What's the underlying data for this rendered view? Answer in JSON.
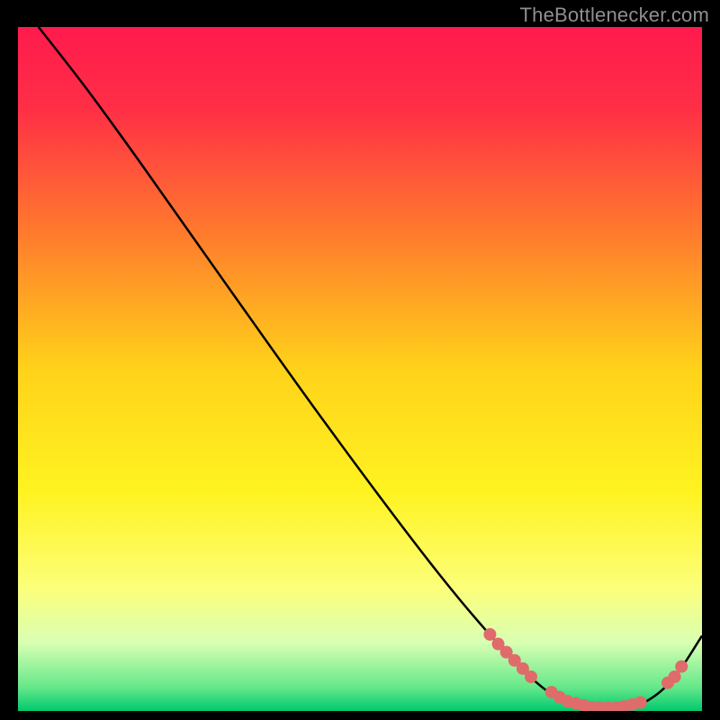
{
  "attribution": "TheBottlenecker.com",
  "chart_data": {
    "type": "line",
    "title": "",
    "xlabel": "",
    "ylabel": "",
    "xlim": [
      0,
      100
    ],
    "ylim": [
      0,
      100
    ],
    "background_gradient": {
      "stops": [
        {
          "pos": 0.0,
          "color": "#ff1a4d"
        },
        {
          "pos": 0.12,
          "color": "#ff2f46"
        },
        {
          "pos": 0.3,
          "color": "#ff7a2d"
        },
        {
          "pos": 0.5,
          "color": "#ffd21a"
        },
        {
          "pos": 0.68,
          "color": "#fff321"
        },
        {
          "pos": 0.82,
          "color": "#fcff7a"
        },
        {
          "pos": 0.9,
          "color": "#d9ffb3"
        },
        {
          "pos": 0.965,
          "color": "#66e88a"
        },
        {
          "pos": 1.0,
          "color": "#00c96e"
        }
      ]
    },
    "curve": [
      {
        "x": 3,
        "y": 100
      },
      {
        "x": 10,
        "y": 91
      },
      {
        "x": 18,
        "y": 80
      },
      {
        "x": 30,
        "y": 63
      },
      {
        "x": 45,
        "y": 42
      },
      {
        "x": 60,
        "y": 22
      },
      {
        "x": 70,
        "y": 10
      },
      {
        "x": 76,
        "y": 4
      },
      {
        "x": 80,
        "y": 1.5
      },
      {
        "x": 84,
        "y": 0.5
      },
      {
        "x": 88,
        "y": 0.5
      },
      {
        "x": 92,
        "y": 1.5
      },
      {
        "x": 96,
        "y": 5
      },
      {
        "x": 100,
        "y": 11
      }
    ],
    "dot_clusters": [
      {
        "x_from": 69,
        "x_to": 75,
        "count": 6
      },
      {
        "x_from": 78,
        "x_to": 91,
        "count": 12
      },
      {
        "x_from": 95,
        "x_to": 97,
        "count": 3
      }
    ],
    "dot_color": "#e06b6b",
    "dot_radius": 7
  }
}
